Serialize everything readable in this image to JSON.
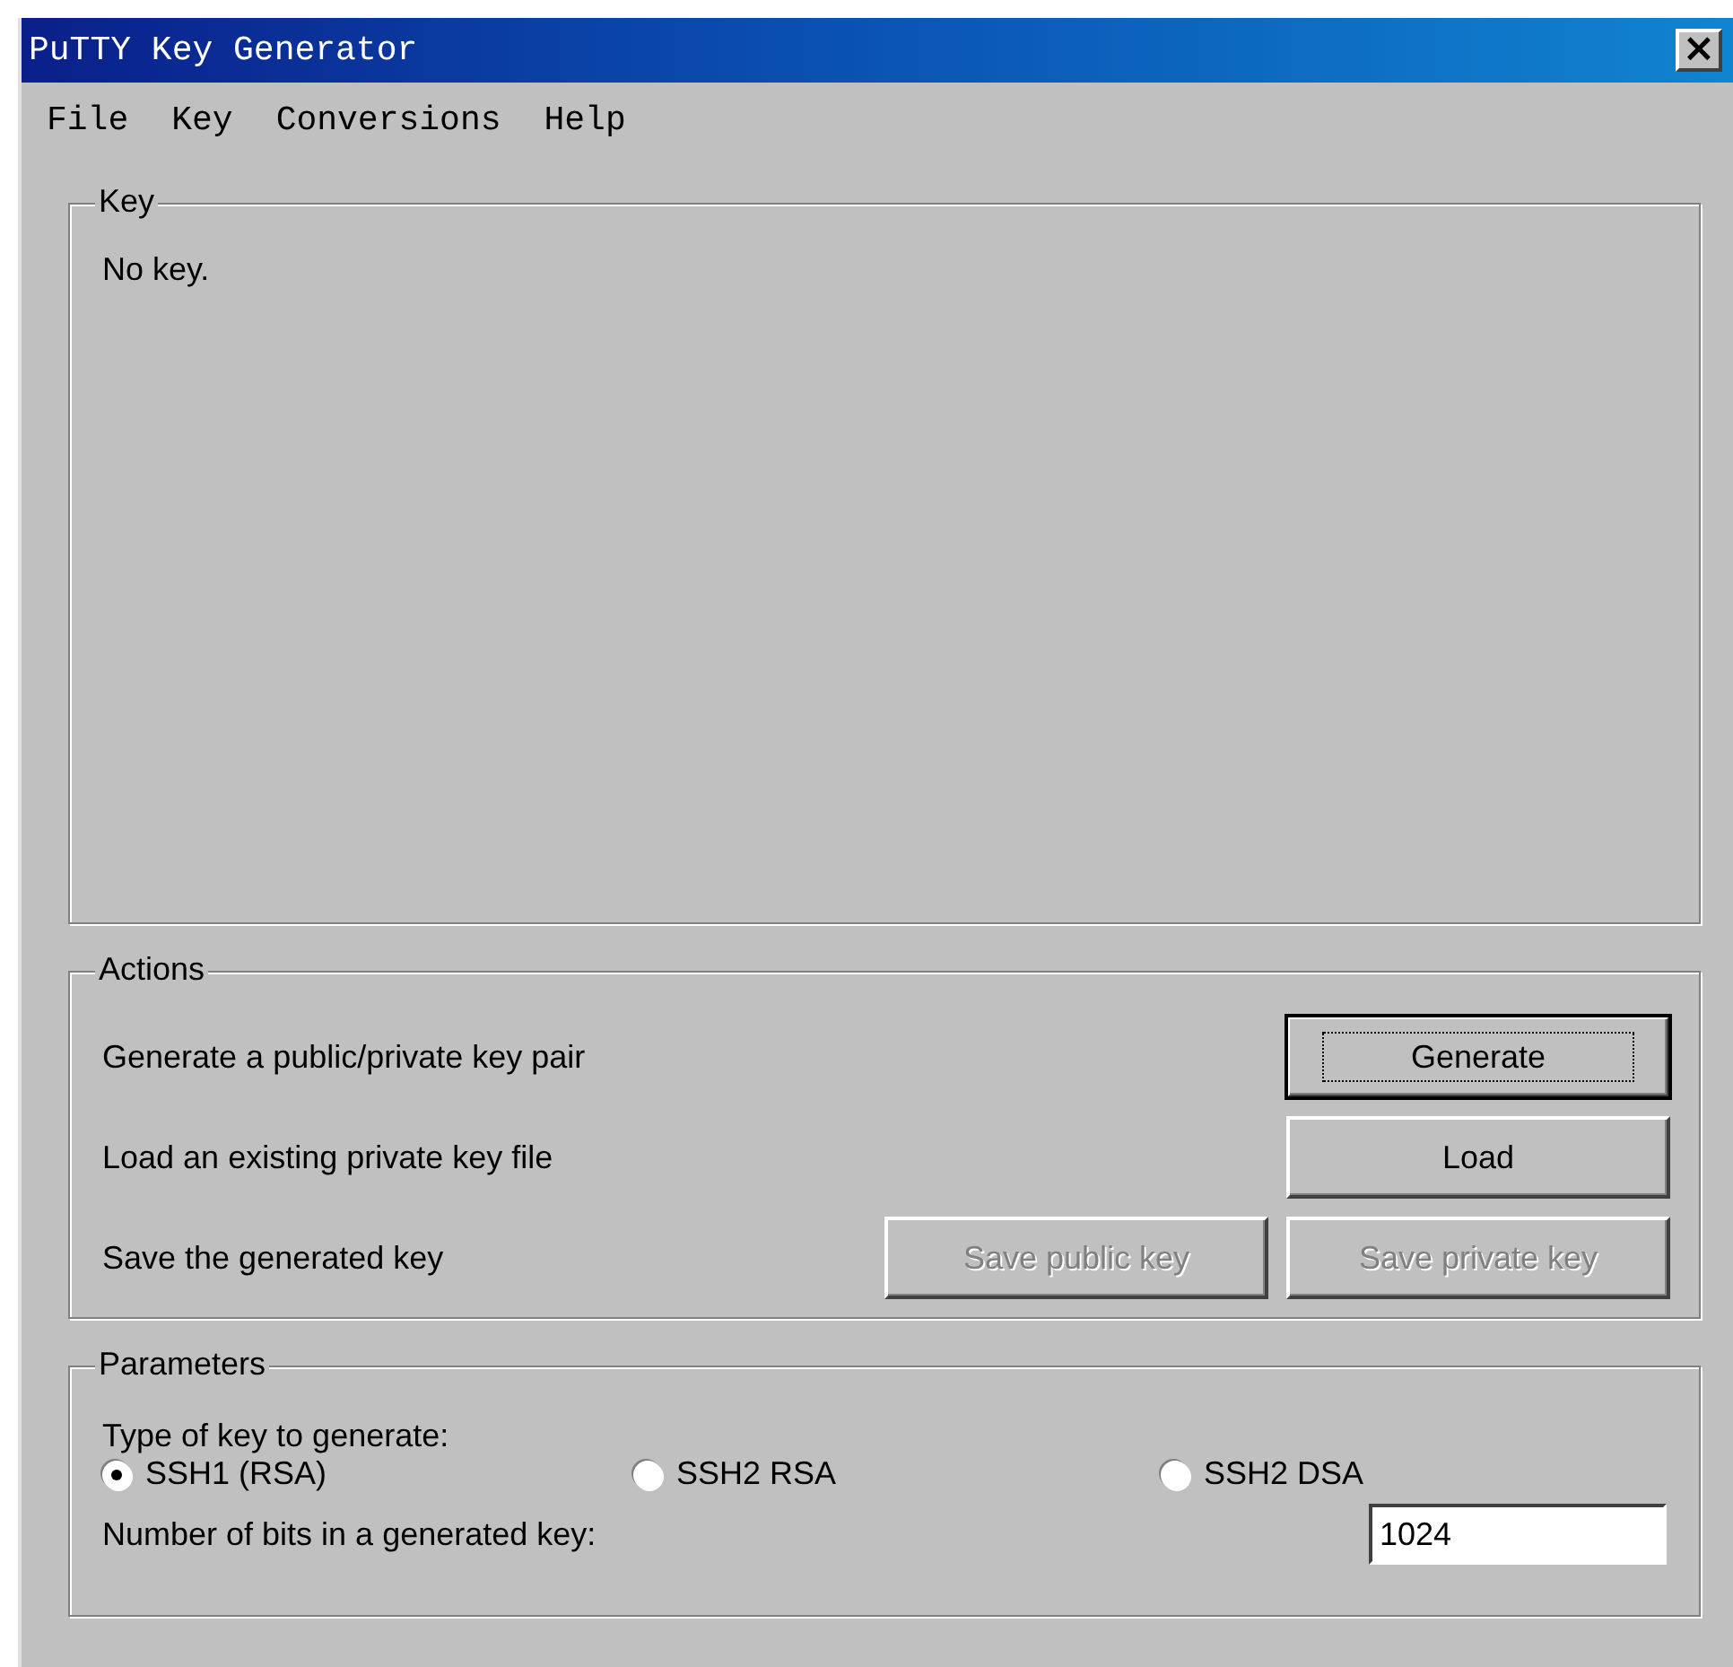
{
  "window": {
    "title": "PuTTY Key Generator",
    "close": "×"
  },
  "menu": [
    "File",
    "Key",
    "Conversions",
    "Help"
  ],
  "key_group": {
    "title": "Key",
    "text": "No key."
  },
  "actions": {
    "title": "Actions",
    "rows": [
      {
        "label": "Generate a public/private key pair",
        "buttons": [
          {
            "label": "Generate",
            "disabled": false,
            "focused": true
          }
        ]
      },
      {
        "label": "Load an existing private key file",
        "buttons": [
          {
            "label": "Load",
            "disabled": false,
            "focused": false
          }
        ]
      },
      {
        "label": "Save the generated key",
        "buttons": [
          {
            "label": "Save public key",
            "disabled": true,
            "focused": false
          },
          {
            "label": "Save private key",
            "disabled": true,
            "focused": false
          }
        ]
      }
    ]
  },
  "parameters": {
    "title": "Parameters",
    "type_label": "Type of key to generate:",
    "types": [
      {
        "label": "SSH1 (RSA)",
        "selected": true
      },
      {
        "label": "SSH2 RSA",
        "selected": false
      },
      {
        "label": "SSH2 DSA",
        "selected": false
      }
    ],
    "bits_label": "Number of bits in a generated key:",
    "bits_value": "1024"
  }
}
